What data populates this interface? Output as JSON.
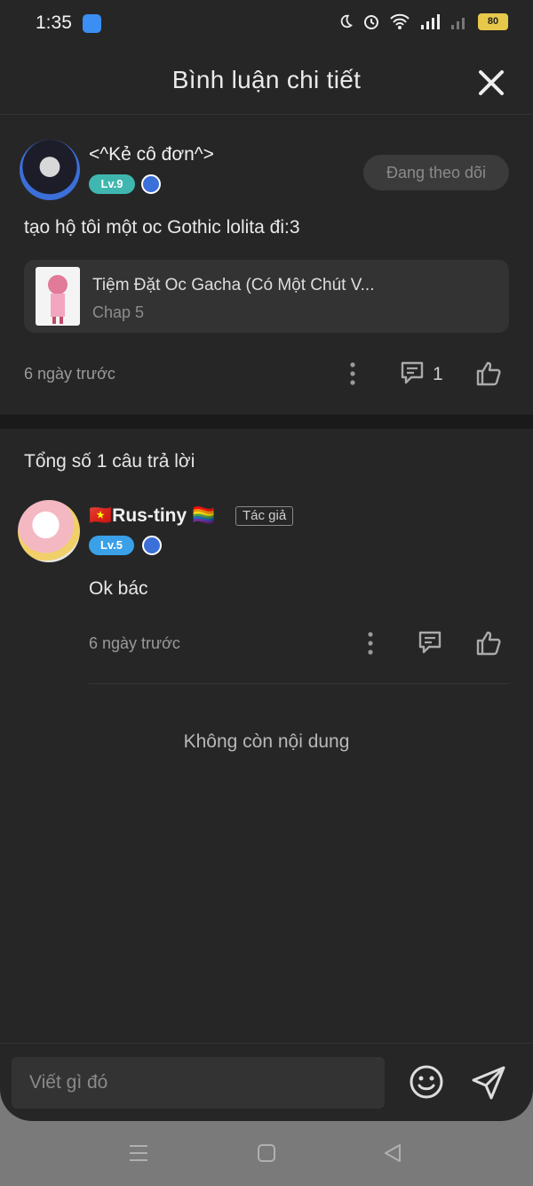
{
  "status_bar": {
    "time": "1:35",
    "battery": "80"
  },
  "header": {
    "title": "Bình luận chi tiết"
  },
  "comment": {
    "author": "<^Kẻ cô đơn^>",
    "level": "Lv.9",
    "follow_label": "Đang theo dõi",
    "text": "tạo hộ tôi một oc Gothic lolita đi:3",
    "story": {
      "title": "Tiệm Đặt Oc Gacha (Có Một Chút V...",
      "chapter": "Chap 5"
    },
    "time": "6 ngày trước",
    "reply_count": "1"
  },
  "replies_header": "Tổng số 1 câu trả lời",
  "reply": {
    "flag": "🇻🇳",
    "author": "Rus-tiny",
    "emoji": "🏳️‍🌈",
    "tag": "Tác giả",
    "level": "Lv.5",
    "text": "Ok bác",
    "time": "6 ngày trước"
  },
  "empty_text": "Không còn nội dung",
  "input": {
    "placeholder": "Viết gì đó"
  },
  "colors": {
    "lv9": "#3fb7b0",
    "lv5": "#3aa0e8",
    "accent": "#3b6fd9"
  }
}
